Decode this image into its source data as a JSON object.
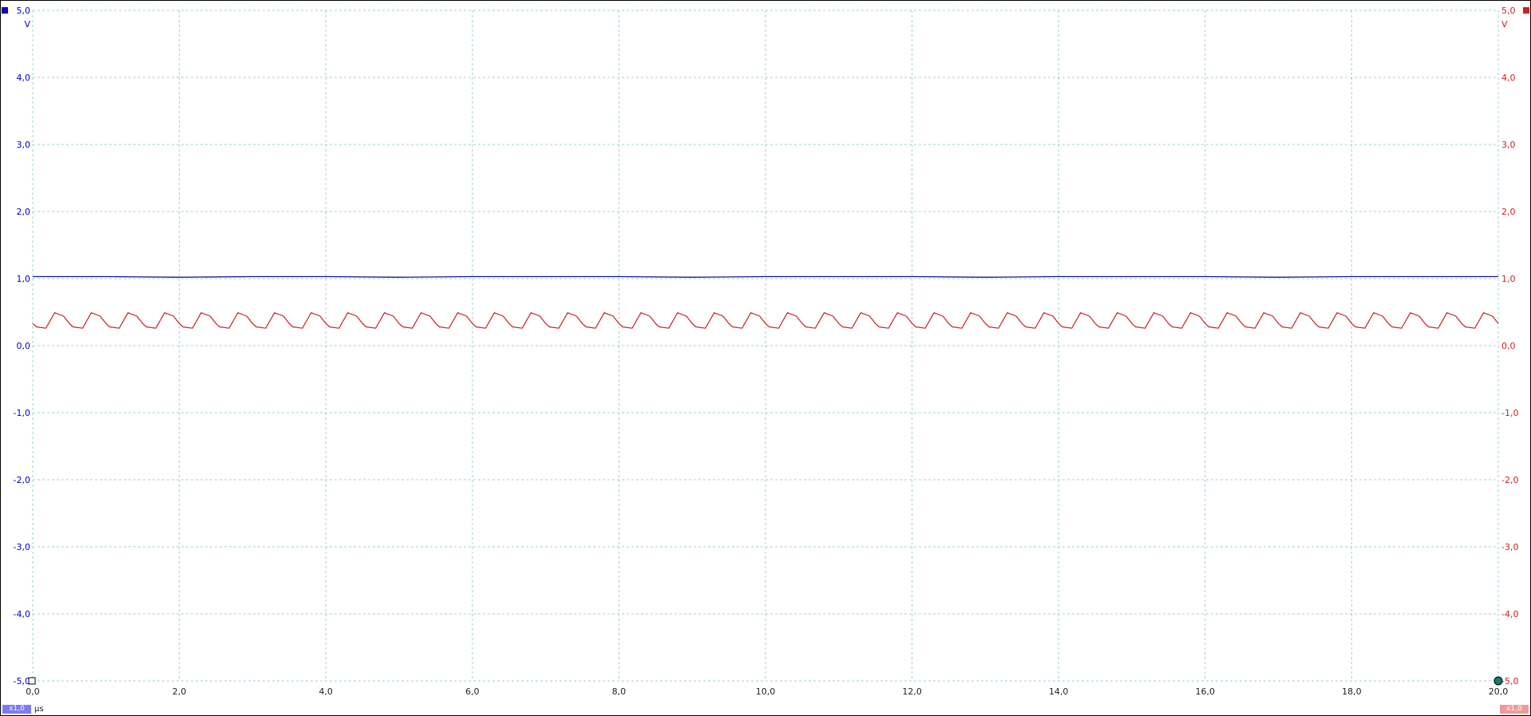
{
  "chart_data": {
    "type": "line",
    "x_unit": "µs",
    "xlim": [
      0,
      20
    ],
    "x_ticks": [
      "0,0",
      "2,0",
      "4,0",
      "6,0",
      "8,0",
      "10,0",
      "12,0",
      "14,0",
      "16,0",
      "18,0",
      "20,0"
    ],
    "left_axis": {
      "unit": "V",
      "ylim": [
        -5,
        5
      ],
      "ticks": [
        "5,0",
        "4,0",
        "3,0",
        "2,0",
        "1,0",
        "0,0",
        "-1,0",
        "-2,0",
        "-3,0",
        "-4,0",
        "-5,0"
      ],
      "color": "#0000c8"
    },
    "right_axis": {
      "unit": "V",
      "ylim": [
        -5,
        5
      ],
      "ticks": [
        "5,0",
        "4,0",
        "3,0",
        "2,0",
        "1,0",
        "0,0",
        "-1,0",
        "-2,0",
        "-3,0",
        "-4,0",
        "-5,0"
      ],
      "color": "#d21e1e"
    },
    "grid": true,
    "series": [
      {
        "channel": "A",
        "color": "#1a1a8c",
        "axis": "left",
        "x": [
          0,
          1,
          2,
          3,
          4,
          5,
          6,
          7,
          8,
          9,
          10,
          11,
          12,
          13,
          14,
          15,
          16,
          17,
          18,
          19,
          20
        ],
        "y": [
          1.03,
          1.03,
          1.02,
          1.03,
          1.03,
          1.02,
          1.03,
          1.03,
          1.03,
          1.02,
          1.03,
          1.03,
          1.03,
          1.02,
          1.03,
          1.03,
          1.03,
          1.02,
          1.03,
          1.03,
          1.03
        ]
      },
      {
        "channel": "B",
        "color": "#cc2020",
        "axis": "right",
        "period": 0.5,
        "x": [
          0,
          0.05,
          0.18,
          0.3,
          0.42,
          0.5,
          0.55,
          0.68,
          0.8,
          0.92,
          1.0
        ],
        "y": [
          0.33,
          0.28,
          0.26,
          0.49,
          0.44,
          0.33,
          0.28,
          0.26,
          0.49,
          0.44,
          0.33
        ]
      }
    ],
    "scale_labels": [
      "x1,0",
      "x1,0"
    ]
  },
  "colors": {
    "grid": "#9fd0d0",
    "background": "#ffffff",
    "left_marker": "#0000c8",
    "right_marker": "#d21e1e",
    "trigger": "#1b7a6e"
  }
}
